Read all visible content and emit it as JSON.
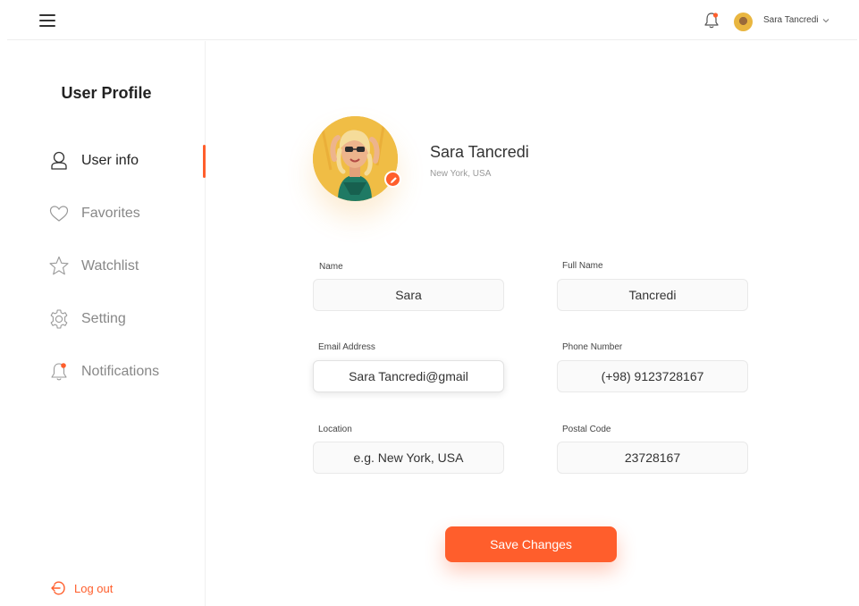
{
  "topbar": {
    "user_name": "Sara Tancredi"
  },
  "sidebar": {
    "title": "User Profile",
    "items": [
      {
        "label": "User info",
        "icon": "user-icon",
        "active": true
      },
      {
        "label": "Favorites",
        "icon": "heart-icon",
        "active": false
      },
      {
        "label": "Watchlist",
        "icon": "star-icon",
        "active": false
      },
      {
        "label": "Setting",
        "icon": "gear-icon",
        "active": false
      },
      {
        "label": "Notifications",
        "icon": "bell-icon",
        "active": false
      }
    ],
    "logout_label": "Log out"
  },
  "profile": {
    "name": "Sara Tancredi",
    "location": "New York, USA"
  },
  "form": {
    "name": {
      "label": "Name",
      "value": "Sara"
    },
    "full_name": {
      "label": "Full Name",
      "value": "Tancredi"
    },
    "email": {
      "label": "Email Address",
      "value": "Sara Tancredi@gmail"
    },
    "phone": {
      "label": "Phone Number",
      "value": "(+98) 9123728167"
    },
    "location": {
      "label": "Location",
      "placeholder": "e.g. New York, USA"
    },
    "postal": {
      "label": "Postal Code",
      "value": "23728167"
    },
    "save_label": "Save Changes"
  },
  "colors": {
    "accent": "#ff5e2c",
    "notification_dot": "#ff5e2c"
  }
}
